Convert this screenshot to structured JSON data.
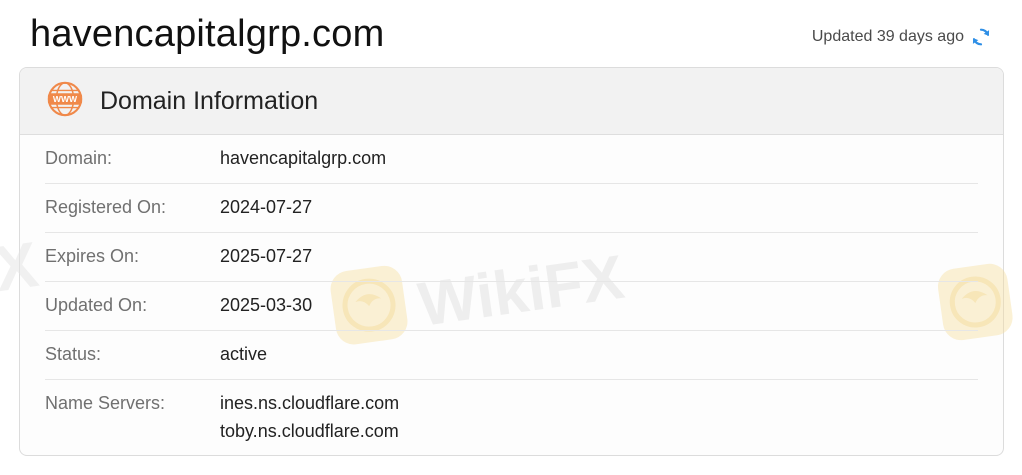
{
  "header": {
    "title": "havencapitalgrp.com",
    "updated_text": "Updated 39 days ago",
    "refresh_icon": "refresh-icon"
  },
  "card": {
    "title": "Domain Information",
    "icon": "www-icon",
    "rows": [
      {
        "label": "Domain:",
        "value": "havencapitalgrp.com"
      },
      {
        "label": "Registered On:",
        "value": "2024-07-27"
      },
      {
        "label": "Expires On:",
        "value": "2025-07-27"
      },
      {
        "label": "Updated On:",
        "value": "2025-03-30"
      },
      {
        "label": "Status:",
        "value": "active"
      },
      {
        "label": "Name Servers:",
        "values": [
          "ines.ns.cloudflare.com",
          "toby.ns.cloudflare.com"
        ]
      }
    ]
  },
  "watermark": {
    "text": "WikiFX",
    "partial_text": "X"
  },
  "colors": {
    "accent_blue": "#2f8fe6",
    "www_orange": "#f0894a",
    "watermark_gold": "#f3d27a"
  }
}
